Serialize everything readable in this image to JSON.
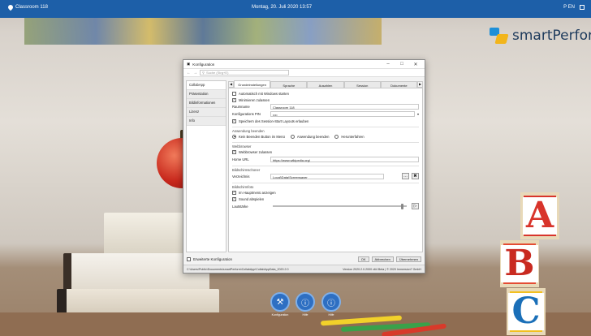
{
  "topbar": {
    "location": "Classroom 118",
    "datetime": "Montag, 20. Juli 2020   13:57",
    "lang": "P EN"
  },
  "brand": {
    "name": "smartPerform"
  },
  "dock": [
    {
      "label": "Konfiguration",
      "icon": "wrench-icon"
    },
    {
      "label": "Hilfe",
      "icon": "help-icon"
    },
    {
      "label": "Hilfe",
      "icon": "info-icon"
    }
  ],
  "dialog": {
    "title": "Konfiguration",
    "search_placeholder": "Suche (Strg+E)",
    "sidebar": [
      "CollabApp",
      "Präsentation",
      "Bildinformationen",
      "Lizenz",
      "Info"
    ],
    "tabs": [
      "Grundeinstellungen",
      "Sprache",
      "Ausahlen",
      "Session",
      "Dokumente"
    ],
    "grund": {
      "autostart": "Automatisch mit Windows starten",
      "minimize": "Minimieren zulassen",
      "room_label": "Raumname",
      "room_value": "Classroom 118",
      "pin_label": "Konfigurations PIN",
      "pin_value": "••••",
      "save_layout": "Speichern des Session-Start Layouts erlauben",
      "exit_section": "Anwendung beenden",
      "exit_opts": [
        "Kein Beenden Button im Menü",
        "Anwendung beenden",
        "Herunterfahren"
      ],
      "web_section": "Webbrowser",
      "web_allow": "Webbrowser zulassen",
      "home_label": "Home URL",
      "home_value": "https://www.wikipedia.org/",
      "screensaver_section": "Bildschirmschoner",
      "dir_label": "Verzeichnis",
      "dir_value": "Local\\Data\\Screensaver",
      "feedback_section": "Bildschirmfoto",
      "feedback_main": "Im Hauptmenü anzeigen",
      "feedback_sound": "Sound abspielen",
      "volume_label": "Lautstärke"
    },
    "extended": "Erweiterte Konfiguration",
    "buttons": {
      "ok": "OK",
      "cancel": "Abbrechen",
      "apply": "Übernehmen"
    },
    "status_path": "C:\\Users\\Public\\Documents\\smartPerform\\CollabApp\\CollabAppData_2020.2.0",
    "status_version": "Version 2020.2.0.2000 x64 Beta | © 2020 Immersion7 GmbH"
  }
}
